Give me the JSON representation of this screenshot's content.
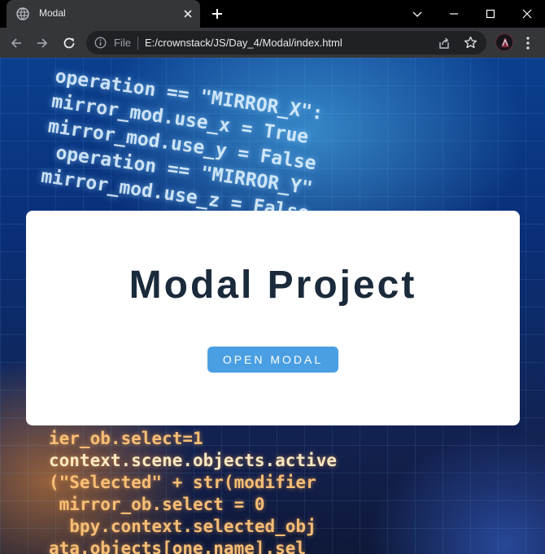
{
  "browser": {
    "tab": {
      "title": "Modal",
      "favicon": "globe-icon"
    },
    "address_bar": {
      "scheme_label": "File",
      "url": "E:/crownstack/JS/Day_4/Modal/index.html"
    },
    "icons": {
      "back": "arrow-left-icon",
      "forward": "arrow-right-icon",
      "reload": "reload-icon",
      "info": "info-icon",
      "share": "share-icon",
      "bookmark": "star-icon",
      "menu": "kebab-menu-icon"
    }
  },
  "page": {
    "card": {
      "title": "Modal Project",
      "button_label": "OPEN MODAL"
    }
  },
  "colors": {
    "card_title": "#1b2a3b",
    "button_bg": "#4a9fe3",
    "button_text": "#ffffff",
    "card_bg": "#ffffff",
    "chrome_dark": "#35363a"
  }
}
